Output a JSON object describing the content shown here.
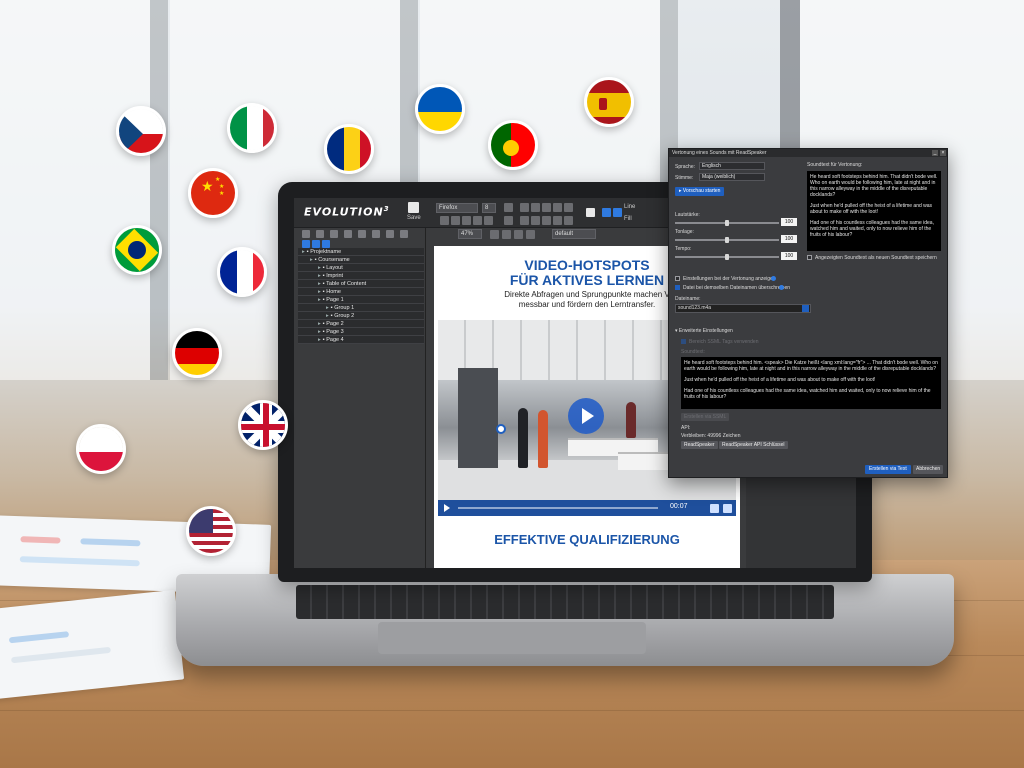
{
  "app": {
    "logo_text": "EVOLUTION",
    "logo_sup": "3",
    "save_label": "Save",
    "font_select": "Firefox",
    "font_size_select": "8",
    "line_label": "Line",
    "fill_label": "Fill",
    "zoom": "47%",
    "layout_select": "default"
  },
  "tree": {
    "items": [
      {
        "label": "Projektname",
        "depth": 0
      },
      {
        "label": "Coursename",
        "depth": 1
      },
      {
        "label": "Layout",
        "depth": 2
      },
      {
        "label": "Imprint",
        "depth": 2
      },
      {
        "label": "Table of Content",
        "depth": 2
      },
      {
        "label": "Home",
        "depth": 2
      },
      {
        "label": "Page 1",
        "depth": 2
      },
      {
        "label": "Group 1",
        "depth": 3
      },
      {
        "label": "Group 2",
        "depth": 3
      },
      {
        "label": "Page 2",
        "depth": 2
      },
      {
        "label": "Page 3",
        "depth": 2
      },
      {
        "label": "Page 4",
        "depth": 2
      }
    ]
  },
  "canvas": {
    "title_line1": "VIDEO-HOTSPOTS",
    "title_line2": "FÜR AKTIVES LERNEN",
    "subtitle_line1": "Direkte Abfragen und Sprungpunkte machen V",
    "subtitle_line2": "messbar und fördern den Lerntransfer.",
    "video_time": "00:07",
    "bottom_title": "EFFEKTIVE QUALIFIZIERUNG"
  },
  "dialog": {
    "title": "Vertonung eines Sounds mit ReadSpeaker",
    "language_label": "Sprache:",
    "language_value": "Englisch",
    "voice_label": "Stimme:",
    "voice_value": "Maja (weiblich)",
    "preview_button": "Vorschau starten",
    "volume_label": "Lautstärke:",
    "volume_value": "100",
    "pitch_label": "Tonlage:",
    "pitch_value": "100",
    "speed_label": "Tempo:",
    "speed_value": "100",
    "source_label": "Soundtext für Vertonung:",
    "source_text": [
      "He heard soft footsteps behind him. That didn't bode well. Who on earth would be following him, late at night and in this narrow alleyway in the middle of the disreputable docklands?",
      "Just when he'd pulled off the heist of a lifetime and was about to make off with the loot!",
      "Had one of his countless colleagues had the same idea, watched him and waited, only to now relieve him of the fruits of his labour?"
    ],
    "save_new_label": "Angezeigten Soundtext als neuen Soundtext speichern",
    "show_settings_label": "Einstellungen bei der Vertonung anzeigen",
    "overwrite_label": "Datei bei demselben Dateinamen überschreiben",
    "filename_label": "Dateiname:",
    "filename_value": "sound123.m4a",
    "advanced_label": "Erweiterte Einstellungen",
    "ssml_label": "Bereich SSML Tags verwenden",
    "ssml_text_label": "Soundtext:",
    "ssml_text": [
      "He heard soft footsteps behind him. <speak> Die Katze heißt <lang xml:lang=\"fr\"> ... That didn't bode well. Who on earth would be following him, late at night and in this narrow alleyway in the middle of the disreputable docklands?",
      "Just when he'd pulled off the heist of a lifetime and was about to make off with the loot!",
      "Had one of his countless colleagues had the same idea, watched him and waited, only to now relieve him of the fruits of his labour?"
    ],
    "ssml_button": "Erstellen via SSML",
    "api_label": "API:",
    "remaining_label": "Verbleiben: 49996  Zeichen",
    "readspeaker_button": "ReadSpeaker",
    "api_key_button": "ReadSpeaker API Schlüssel",
    "create_button": "Erstellen via Text",
    "cancel_button": "Abbrechen"
  },
  "colors": {
    "accent_blue": "#1f5fbf",
    "heading_blue": "#1b55a8",
    "dialog_bg": "#3b3c3f"
  },
  "flags": [
    {
      "name": "czech-flag-icon"
    },
    {
      "name": "italy-flag-icon"
    },
    {
      "name": "romania-flag-icon"
    },
    {
      "name": "ukraine-flag-icon"
    },
    {
      "name": "portugal-flag-icon"
    },
    {
      "name": "spain-flag-icon"
    },
    {
      "name": "china-flag-icon"
    },
    {
      "name": "brazil-flag-icon"
    },
    {
      "name": "france-flag-icon"
    },
    {
      "name": "germany-flag-icon"
    },
    {
      "name": "uk-flag-icon"
    },
    {
      "name": "poland-flag-icon"
    },
    {
      "name": "usa-flag-icon"
    }
  ]
}
